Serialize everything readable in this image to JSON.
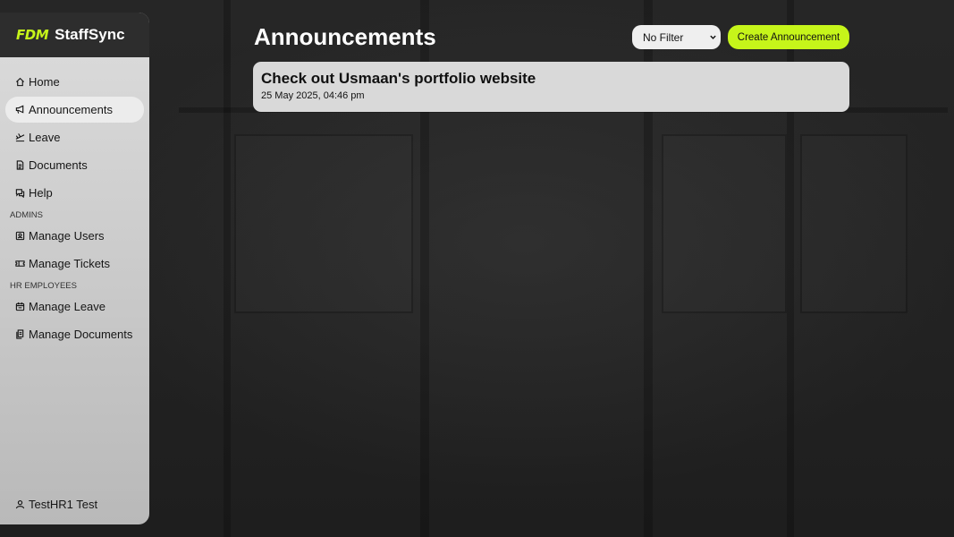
{
  "brand": {
    "logo": "FDM",
    "name": "StaffSync"
  },
  "sidebar": {
    "items": [
      {
        "label": "Home",
        "icon": "home-icon"
      },
      {
        "label": "Announcements",
        "icon": "megaphone-icon",
        "active": true
      },
      {
        "label": "Leave",
        "icon": "plane-icon"
      },
      {
        "label": "Documents",
        "icon": "document-icon"
      },
      {
        "label": "Help",
        "icon": "chat-icon"
      }
    ],
    "admins_label": "ADMINS",
    "admin_items": [
      {
        "label": "Manage Users",
        "icon": "user-card-icon"
      },
      {
        "label": "Manage Tickets",
        "icon": "ticket-icon"
      }
    ],
    "hr_label": "HR EMPLOYEES",
    "hr_items": [
      {
        "label": "Manage Leave",
        "icon": "calendar-icon"
      },
      {
        "label": "Manage Documents",
        "icon": "files-icon"
      }
    ],
    "user": {
      "name": "TestHR1 Test",
      "icon": "user-icon"
    }
  },
  "main": {
    "title": "Announcements",
    "filter": {
      "selected": "No Filter"
    },
    "create_label": "Create Announcement",
    "announcements": [
      {
        "title": "Check out Usmaan's portfolio website",
        "date": "25 May 2025, 04:46 pm"
      }
    ]
  },
  "colors": {
    "accent": "#c6f51a",
    "background": "#232323",
    "sidebar": "#d0d0d0",
    "card": "#d9d9d9"
  }
}
